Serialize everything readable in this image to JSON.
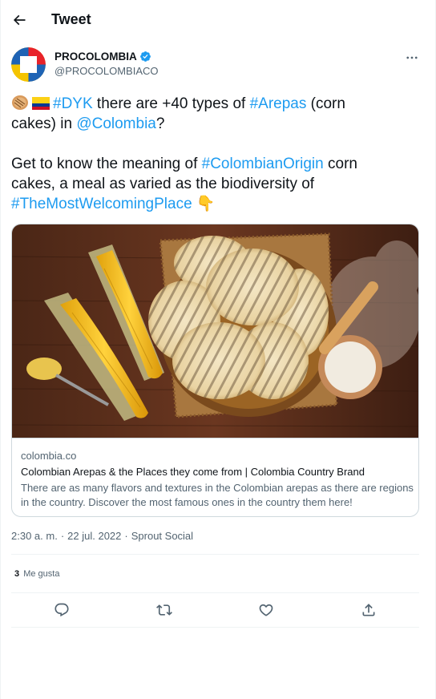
{
  "header": {
    "title": "Tweet"
  },
  "author": {
    "name": "PROCOLOMBIA",
    "handle": "@PROCOLOMBIACO"
  },
  "tweet": {
    "line1_link1": "#DYK",
    "line1_text1": " there are +40 types of ",
    "line1_link2": "#Arepas",
    "line1_text2": " (corn",
    "line2_text1": "cakes) in ",
    "line2_link1": "@Colombia",
    "line2_text2": "?",
    "line3_text1": "Get to know the meaning of ",
    "line3_link1": "#ColombianOrigin",
    "line3_text2": " corn",
    "line4_text1": "cakes, a meal as varied as the biodiversity of",
    "line5_link1": "#TheMostWelcomingPlace",
    "line5_emoji": "👇"
  },
  "card": {
    "domain": "colombia.co",
    "title": "Colombian Arepas & the Places they come from | Colombia Country Brand",
    "description": "There are as many flavors and textures in the Colombian arepas as there are regions in the country. Discover the most famous ones in the country them here!"
  },
  "meta": {
    "time": "2:30 a. m.",
    "separator1": "·",
    "date": "22 jul. 2022",
    "separator2": "·",
    "source": "Sprout Social"
  },
  "stats": {
    "likes_count": "3",
    "likes_label": "Me gusta"
  },
  "colors": {
    "accent": "#1d9bf0",
    "text": "#0f1419",
    "secondary": "#536471",
    "border": "#cfd9de"
  },
  "icons": [
    "back-arrow-icon",
    "verified-badge-icon",
    "more-icon",
    "reply-icon",
    "retweet-icon",
    "like-icon",
    "share-icon"
  ]
}
